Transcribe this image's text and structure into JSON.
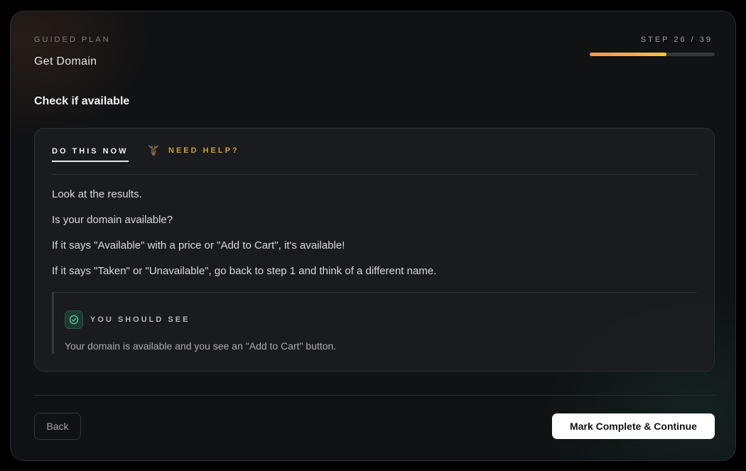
{
  "header": {
    "eyebrow": "GUIDED PLAN",
    "plan_title": "Get Domain",
    "step_counter": "STEP 26 / 39",
    "progress_fraction": 0.6154,
    "progress_colors": [
      "#f09a45",
      "#f4c24a"
    ]
  },
  "step": {
    "heading": "Check if available"
  },
  "tabs": {
    "active_label": "DO THIS NOW",
    "help_label": "NEED HELP?",
    "help_icon": "moose-icon"
  },
  "instructions": [
    "Look at the results.",
    "Is your domain available?",
    "If it says \"Available\" with a price or \"Add to Cart\", it's available!",
    "If it says \"Taken\" or \"Unavailable\", go back to step 1 and think of a different name."
  ],
  "expectation": {
    "title": "YOU SHOULD SEE",
    "icon": "check-circle-icon",
    "text": "Your domain is available and you see an \"Add to Cart\" button."
  },
  "footer": {
    "back_label": "Back",
    "continue_label": "Mark Complete & Continue"
  }
}
